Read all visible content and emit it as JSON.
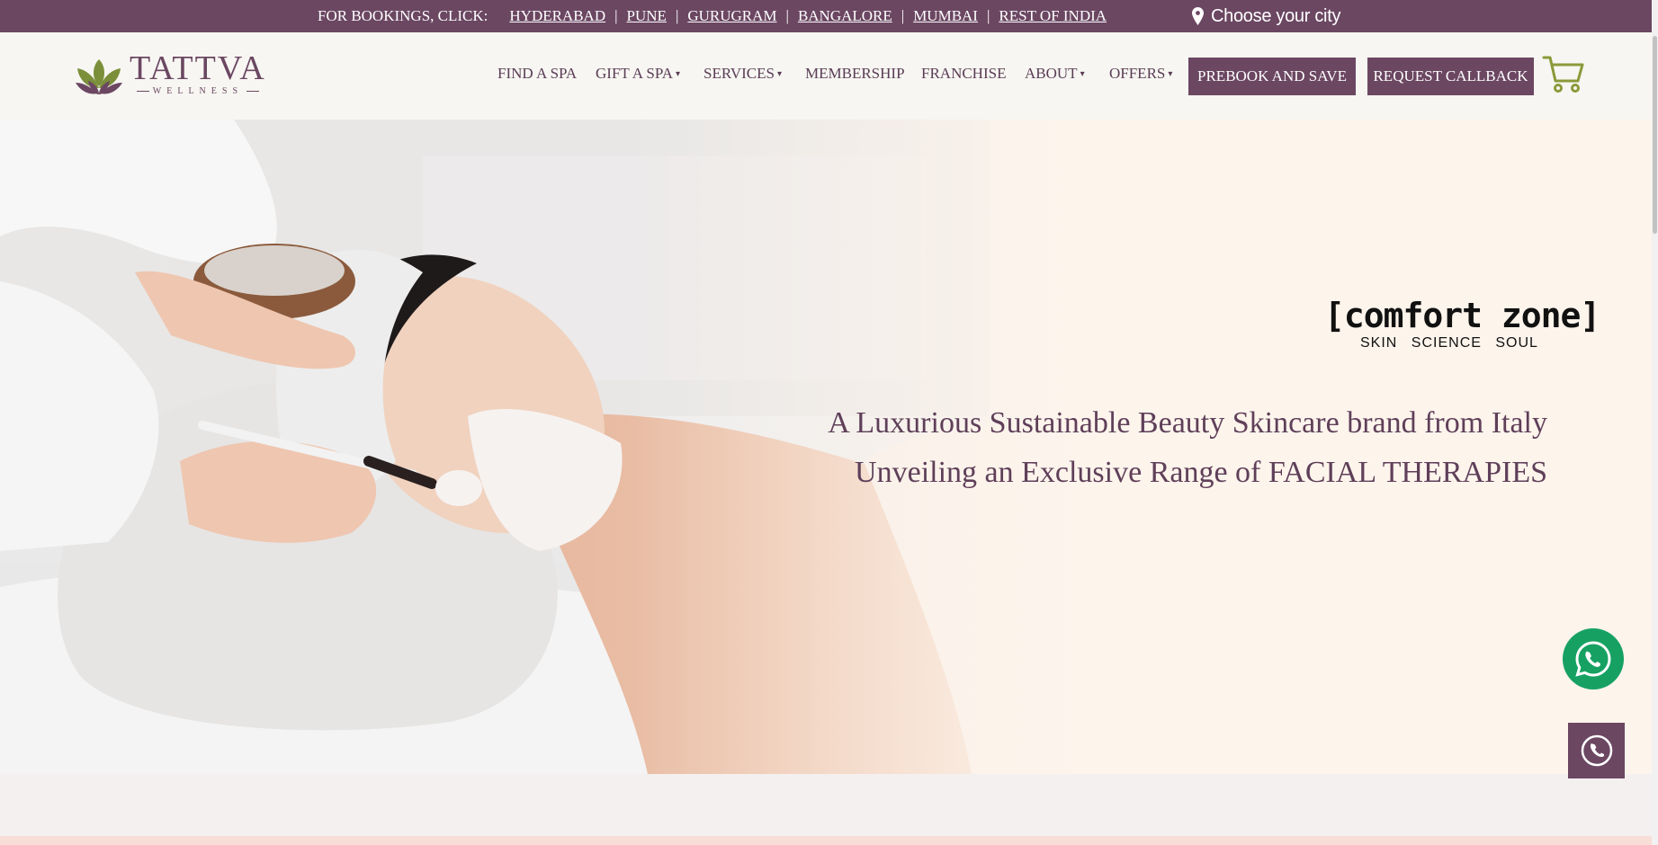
{
  "topbar": {
    "booking_label": "FOR BOOKINGS, CLICK:",
    "cities": [
      "HYDERABAD",
      "PUNE",
      "GURUGRAM",
      "BANGALORE",
      "MUMBAI",
      "REST OF INDIA"
    ],
    "separator": "|",
    "choose_city": "Choose your city",
    "choose_icon": "map-pin-icon"
  },
  "header": {
    "logo_word": "TATTVA",
    "logo_sub": "WELLNESS",
    "nav": {
      "find_spa": "FIND A SPA",
      "gift_spa": "GIFT A SPA",
      "services": "SERVICES",
      "membership": "MEMBERSHIP",
      "franchise": "FRANCHISE",
      "about": "ABOUT",
      "offers": "OFFERS"
    },
    "prebook": "PREBOOK AND SAVE",
    "callback": "REQUEST CALLBACK",
    "cart_icon": "shopping-cart-icon"
  },
  "hero": {
    "brand_logo": "[comfort zone]",
    "brand_tagline": "SKIN SCIENCE SOUL",
    "headline_1": "A Luxurious Sustainable Beauty Skincare brand from Italy",
    "headline_2": "Unveiling an Exclusive Range of FACIAL THERAPIES"
  },
  "floating": {
    "whatsapp_icon": "whatsapp-icon",
    "call_icon": "phone-icon"
  },
  "colors": {
    "brand_purple": "#6b4762",
    "logo_green": "#7b8f3a",
    "whatsapp_green": "#16a163",
    "header_bg": "#f7f6f2"
  }
}
